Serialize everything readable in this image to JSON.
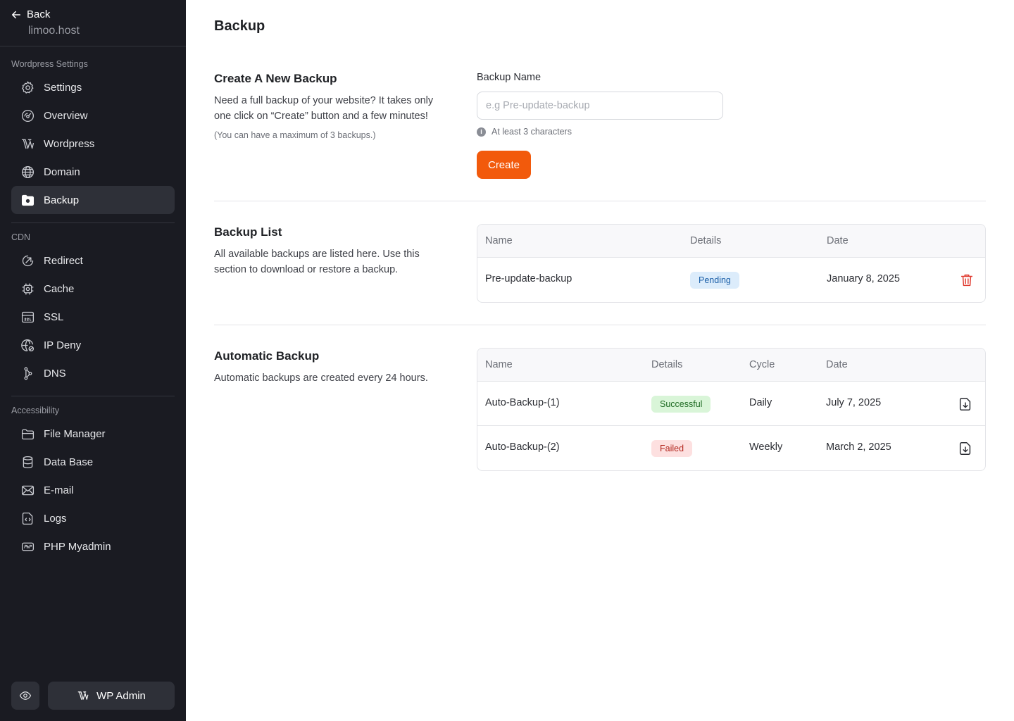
{
  "sidebar": {
    "back_label": "Back",
    "site_name": "limoo.host",
    "sections": [
      {
        "label": "Wordpress Settings",
        "items": [
          {
            "label": "Settings",
            "icon": "gear-icon"
          },
          {
            "label": "Overview",
            "icon": "gauge-icon"
          },
          {
            "label": "Wordpress",
            "icon": "wordpress-icon"
          },
          {
            "label": "Domain",
            "icon": "globe-icon"
          },
          {
            "label": "Backup",
            "icon": "backup-icon",
            "active": true
          }
        ]
      },
      {
        "label": "CDN",
        "items": [
          {
            "label": "Redirect",
            "icon": "redirect-icon"
          },
          {
            "label": "Cache",
            "icon": "chip-icon"
          },
          {
            "label": "SSL",
            "icon": "ssl-icon"
          },
          {
            "label": "IP Deny",
            "icon": "globe-deny-icon"
          },
          {
            "label": "DNS",
            "icon": "dns-icon"
          }
        ]
      },
      {
        "label": "Accessibility",
        "items": [
          {
            "label": "File Manager",
            "icon": "folder-icon"
          },
          {
            "label": "Data Base",
            "icon": "database-icon"
          },
          {
            "label": "E-mail",
            "icon": "mail-icon"
          },
          {
            "label": "Logs",
            "icon": "code-file-icon"
          },
          {
            "label": "PHP Myadmin",
            "icon": "php-icon"
          }
        ]
      }
    ],
    "wp_admin_label": "WP Admin"
  },
  "page": {
    "title": "Backup"
  },
  "create": {
    "title": "Create A New Backup",
    "description": "Need a full backup of your website? It takes only one click on “Create” button and a few minutes!",
    "note": "(You can have a maximum of 3 backups.)",
    "field_label": "Backup Name",
    "placeholder": "e.g Pre-update-backup",
    "value": "",
    "hint": "At least 3 characters",
    "button_label": "Create"
  },
  "backup_list": {
    "title": "Backup List",
    "description": "All available backups are listed here. Use this section to download or restore a backup.",
    "columns": [
      "Name",
      "Details",
      "Date"
    ],
    "rows": [
      {
        "name": "Pre-update-backup",
        "status": "Pending",
        "date": "January 8, 2025"
      }
    ]
  },
  "automatic": {
    "title": "Automatic Backup",
    "description": "Automatic backups are created every 24 hours.",
    "columns": [
      "Name",
      "Details",
      "Cycle",
      "Date"
    ],
    "rows": [
      {
        "name": "Auto-Backup-(1)",
        "status": "Successful",
        "cycle": "Daily",
        "date": "July 7, 2025"
      },
      {
        "name": "Auto-Backup-(2)",
        "status": "Failed",
        "cycle": "Weekly",
        "date": "March 2, 2025"
      }
    ]
  },
  "colors": {
    "sidebar_bg": "#1a1b22",
    "accent": "#f25a0c",
    "pending": "#1b5fa8",
    "success": "#1f6b23",
    "failed": "#b3261e"
  }
}
